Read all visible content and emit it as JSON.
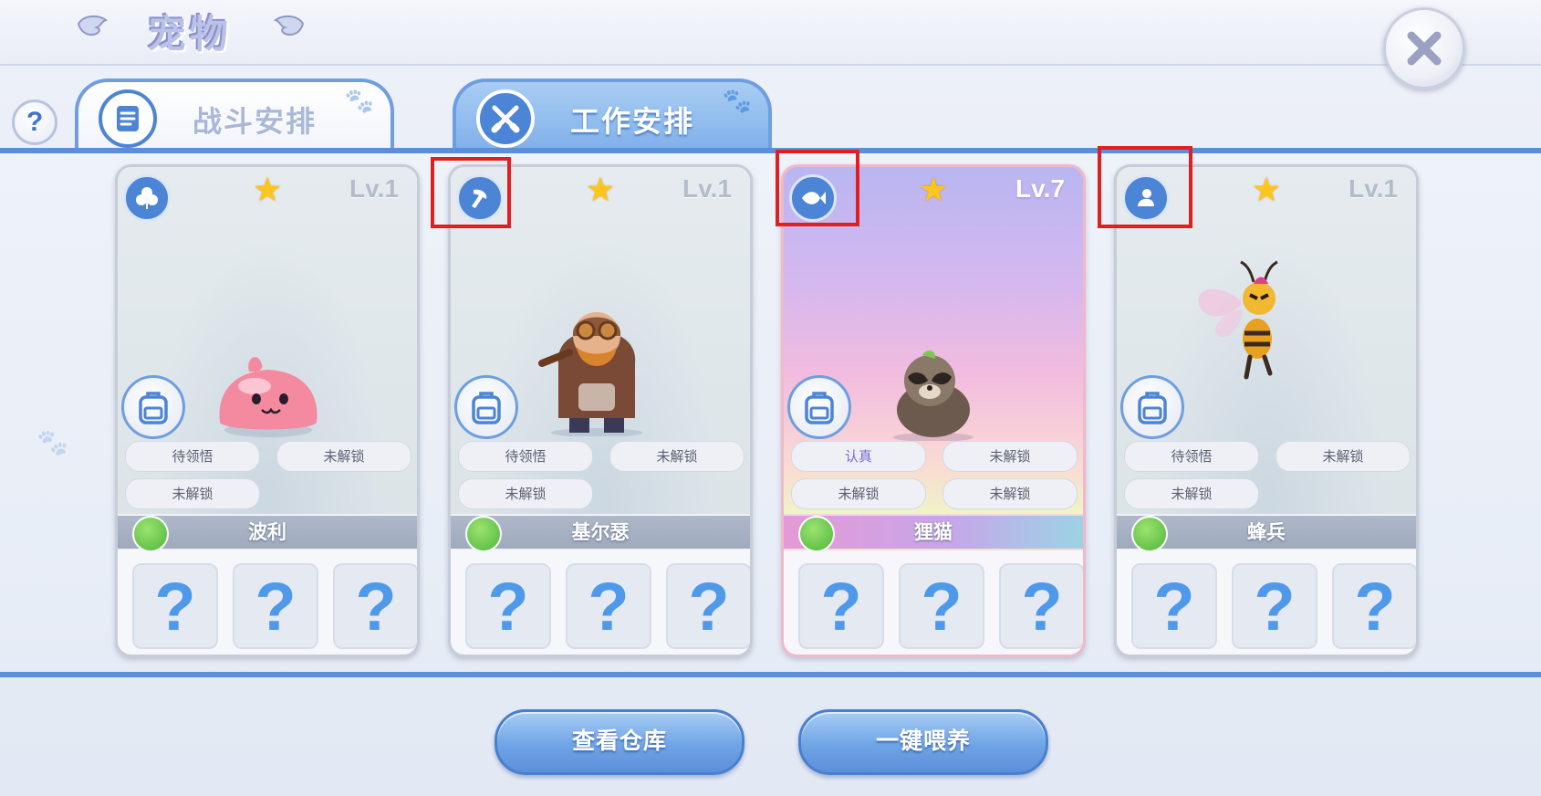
{
  "header": {
    "title": "宠物"
  },
  "tabs": [
    {
      "label": "战斗安排",
      "active": false
    },
    {
      "label": "工作安排",
      "active": true
    }
  ],
  "help": {
    "label": "?"
  },
  "cards": [
    {
      "class_icon": "clover-icon",
      "level": "Lv.1",
      "skills": [
        "待领悟",
        "未解锁",
        "未解锁"
      ],
      "name": "波利",
      "slots": [
        "?",
        "?",
        "?"
      ]
    },
    {
      "class_icon": "hammer-icon",
      "level": "Lv.1",
      "skills": [
        "待领悟",
        "未解锁",
        "未解锁"
      ],
      "name": "基尔瑟",
      "slots": [
        "?",
        "?",
        "?"
      ]
    },
    {
      "class_icon": "fish-icon",
      "level": "Lv.7",
      "skills": [
        "认真",
        "未解锁",
        "未解锁",
        "未解锁"
      ],
      "name": "狸猫",
      "slots": [
        "?",
        "?",
        "?"
      ]
    },
    {
      "class_icon": "bird-icon",
      "level": "Lv.1",
      "skills": [
        "待领悟",
        "未解锁",
        "未解锁"
      ],
      "name": "蜂兵",
      "slots": [
        "?",
        "?",
        "?"
      ]
    }
  ],
  "buttons": {
    "warehouse": "查看仓库",
    "feed_all": "一键喂养"
  },
  "colors": {
    "accent": "#5c8fdb",
    "highlight": "#e02020",
    "star": "#ffc61a"
  }
}
